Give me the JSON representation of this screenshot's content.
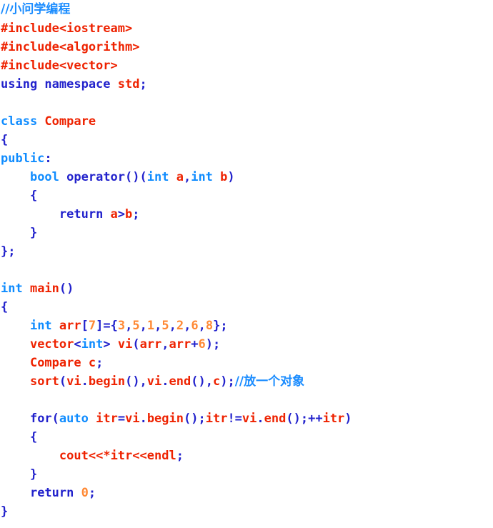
{
  "editor": {
    "language": "C++",
    "background_color": "#ffffff",
    "colors": {
      "comment": "#1a8cff",
      "preprocessor": "#ee2200",
      "keyword": "#2222cc",
      "type_keyword": "#0f8cff",
      "identifier": "#ee2200",
      "number": "#ff8833",
      "punctuation": "#2222cc"
    }
  },
  "code": {
    "lines": [
      {
        "n": 1,
        "text": "//小问学编程",
        "tokens": [
          {
            "t": "//小问学编程",
            "c": "comment",
            "cjk": true
          }
        ]
      },
      {
        "n": 2,
        "text": "#include<iostream>",
        "tokens": [
          {
            "t": "#include<iostream>",
            "c": "preproc"
          }
        ]
      },
      {
        "n": 3,
        "text": "#include<algorithm>",
        "tokens": [
          {
            "t": "#include<algorithm>",
            "c": "preproc"
          }
        ]
      },
      {
        "n": 4,
        "text": "#include<vector>",
        "tokens": [
          {
            "t": "#include<vector>",
            "c": "preproc"
          }
        ]
      },
      {
        "n": 5,
        "text": "using namespace std;",
        "tokens": [
          {
            "t": "using namespace ",
            "c": "keyword"
          },
          {
            "t": "std",
            "c": "ident"
          },
          {
            "t": ";",
            "c": "punct"
          }
        ]
      },
      {
        "n": 6,
        "text": "",
        "tokens": []
      },
      {
        "n": 7,
        "text": "class Compare",
        "tokens": [
          {
            "t": "class ",
            "c": "type"
          },
          {
            "t": "Compare",
            "c": "ident"
          }
        ]
      },
      {
        "n": 8,
        "text": "{",
        "tokens": [
          {
            "t": "{",
            "c": "punct"
          }
        ]
      },
      {
        "n": 9,
        "text": "public:",
        "tokens": [
          {
            "t": "public",
            "c": "type"
          },
          {
            "t": ":",
            "c": "punct"
          }
        ]
      },
      {
        "n": 10,
        "text": "    bool operator()(int a,int b)",
        "tokens": [
          {
            "t": "    ",
            "c": "plain"
          },
          {
            "t": "bool ",
            "c": "type"
          },
          {
            "t": "operator",
            "c": "keyword"
          },
          {
            "t": "()(",
            "c": "punct"
          },
          {
            "t": "int ",
            "c": "type"
          },
          {
            "t": "a",
            "c": "ident"
          },
          {
            "t": ",",
            "c": "punct"
          },
          {
            "t": "int ",
            "c": "type"
          },
          {
            "t": "b",
            "c": "ident"
          },
          {
            "t": ")",
            "c": "punct"
          }
        ]
      },
      {
        "n": 11,
        "text": "    {",
        "tokens": [
          {
            "t": "    {",
            "c": "punct"
          }
        ]
      },
      {
        "n": 12,
        "text": "        return a>b;",
        "tokens": [
          {
            "t": "        ",
            "c": "plain"
          },
          {
            "t": "return ",
            "c": "keyword"
          },
          {
            "t": "a",
            "c": "ident"
          },
          {
            "t": ">",
            "c": "punct"
          },
          {
            "t": "b",
            "c": "ident"
          },
          {
            "t": ";",
            "c": "punct"
          }
        ]
      },
      {
        "n": 13,
        "text": "    }",
        "tokens": [
          {
            "t": "    }",
            "c": "punct"
          }
        ]
      },
      {
        "n": 14,
        "text": "};",
        "tokens": [
          {
            "t": "};",
            "c": "punct"
          }
        ]
      },
      {
        "n": 15,
        "text": "",
        "tokens": []
      },
      {
        "n": 16,
        "text": "int main()",
        "tokens": [
          {
            "t": "int ",
            "c": "type"
          },
          {
            "t": "main",
            "c": "ident"
          },
          {
            "t": "()",
            "c": "punct"
          }
        ]
      },
      {
        "n": 17,
        "text": "{",
        "tokens": [
          {
            "t": "{",
            "c": "punct"
          }
        ]
      },
      {
        "n": 18,
        "text": "    int arr[7]={3,5,1,5,2,6,8};",
        "tokens": [
          {
            "t": "    ",
            "c": "plain"
          },
          {
            "t": "int ",
            "c": "type"
          },
          {
            "t": "arr",
            "c": "ident"
          },
          {
            "t": "[",
            "c": "punct"
          },
          {
            "t": "7",
            "c": "number"
          },
          {
            "t": "]={",
            "c": "punct"
          },
          {
            "t": "3",
            "c": "number"
          },
          {
            "t": ",",
            "c": "punct"
          },
          {
            "t": "5",
            "c": "number"
          },
          {
            "t": ",",
            "c": "punct"
          },
          {
            "t": "1",
            "c": "number"
          },
          {
            "t": ",",
            "c": "punct"
          },
          {
            "t": "5",
            "c": "number"
          },
          {
            "t": ",",
            "c": "punct"
          },
          {
            "t": "2",
            "c": "number"
          },
          {
            "t": ",",
            "c": "punct"
          },
          {
            "t": "6",
            "c": "number"
          },
          {
            "t": ",",
            "c": "punct"
          },
          {
            "t": "8",
            "c": "number"
          },
          {
            "t": "};",
            "c": "punct"
          }
        ]
      },
      {
        "n": 19,
        "text": "    vector<int> vi(arr,arr+6);",
        "tokens": [
          {
            "t": "    ",
            "c": "plain"
          },
          {
            "t": "vector",
            "c": "ident"
          },
          {
            "t": "<",
            "c": "punct"
          },
          {
            "t": "int",
            "c": "type"
          },
          {
            "t": "> ",
            "c": "punct"
          },
          {
            "t": "vi",
            "c": "ident"
          },
          {
            "t": "(",
            "c": "punct"
          },
          {
            "t": "arr",
            "c": "ident"
          },
          {
            "t": ",",
            "c": "punct"
          },
          {
            "t": "arr",
            "c": "ident"
          },
          {
            "t": "+",
            "c": "punct"
          },
          {
            "t": "6",
            "c": "number"
          },
          {
            "t": ");",
            "c": "punct"
          }
        ]
      },
      {
        "n": 20,
        "text": "    Compare c;",
        "tokens": [
          {
            "t": "    ",
            "c": "plain"
          },
          {
            "t": "Compare c",
            "c": "ident"
          },
          {
            "t": ";",
            "c": "punct"
          }
        ]
      },
      {
        "n": 21,
        "text": "    sort(vi.begin(),vi.end(),c);//放一个对象",
        "tokens": [
          {
            "t": "    ",
            "c": "plain"
          },
          {
            "t": "sort",
            "c": "ident"
          },
          {
            "t": "(",
            "c": "punct"
          },
          {
            "t": "vi",
            "c": "ident"
          },
          {
            "t": ".",
            "c": "punct"
          },
          {
            "t": "begin",
            "c": "ident"
          },
          {
            "t": "(),",
            "c": "punct"
          },
          {
            "t": "vi",
            "c": "ident"
          },
          {
            "t": ".",
            "c": "punct"
          },
          {
            "t": "end",
            "c": "ident"
          },
          {
            "t": "(),",
            "c": "punct"
          },
          {
            "t": "c",
            "c": "ident"
          },
          {
            "t": ");",
            "c": "punct"
          },
          {
            "t": "//放一个对象",
            "c": "comment",
            "cjk": true
          }
        ]
      },
      {
        "n": 22,
        "text": "",
        "tokens": []
      },
      {
        "n": 23,
        "text": "    for(auto itr=vi.begin();itr!=vi.end();++itr)",
        "tokens": [
          {
            "t": "    ",
            "c": "plain"
          },
          {
            "t": "for",
            "c": "keyword"
          },
          {
            "t": "(",
            "c": "punct"
          },
          {
            "t": "auto ",
            "c": "type"
          },
          {
            "t": "itr",
            "c": "ident"
          },
          {
            "t": "=",
            "c": "punct"
          },
          {
            "t": "vi",
            "c": "ident"
          },
          {
            "t": ".",
            "c": "punct"
          },
          {
            "t": "begin",
            "c": "ident"
          },
          {
            "t": "();",
            "c": "punct"
          },
          {
            "t": "itr",
            "c": "ident"
          },
          {
            "t": "!=",
            "c": "punct"
          },
          {
            "t": "vi",
            "c": "ident"
          },
          {
            "t": ".",
            "c": "punct"
          },
          {
            "t": "end",
            "c": "ident"
          },
          {
            "t": "();",
            "c": "punct"
          },
          {
            "t": "++",
            "c": "punct"
          },
          {
            "t": "itr",
            "c": "ident"
          },
          {
            "t": ")",
            "c": "punct"
          }
        ]
      },
      {
        "n": 24,
        "text": "    {",
        "tokens": [
          {
            "t": "    {",
            "c": "punct"
          }
        ]
      },
      {
        "n": 25,
        "text": "        cout<<*itr<<endl;",
        "tokens": [
          {
            "t": "        ",
            "c": "plain"
          },
          {
            "t": "cout",
            "c": "ident"
          },
          {
            "t": "<<*",
            "c": "ident"
          },
          {
            "t": "itr",
            "c": "ident"
          },
          {
            "t": "<<",
            "c": "ident"
          },
          {
            "t": "endl",
            "c": "ident"
          },
          {
            "t": ";",
            "c": "punct"
          }
        ]
      },
      {
        "n": 26,
        "text": "    }",
        "tokens": [
          {
            "t": "    }",
            "c": "punct"
          }
        ]
      },
      {
        "n": 27,
        "text": "    return 0;",
        "tokens": [
          {
            "t": "    ",
            "c": "plain"
          },
          {
            "t": "return ",
            "c": "keyword"
          },
          {
            "t": "0",
            "c": "number"
          },
          {
            "t": ";",
            "c": "punct"
          }
        ]
      },
      {
        "n": 28,
        "text": "}",
        "tokens": [
          {
            "t": "}",
            "c": "punct"
          }
        ]
      }
    ]
  }
}
